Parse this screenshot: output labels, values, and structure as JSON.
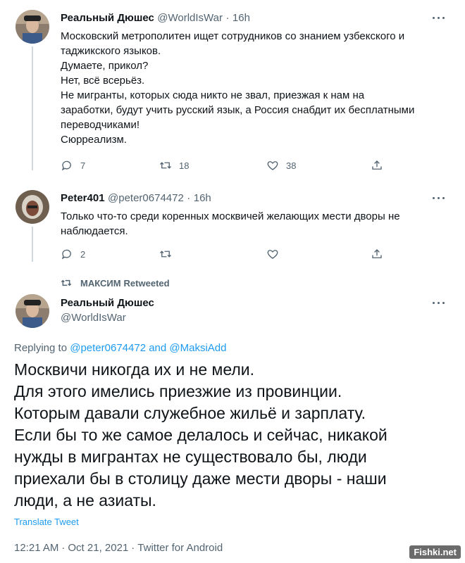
{
  "tweet1": {
    "name": "Реальный Дюшес",
    "handle": "@WorldIsWar",
    "time": "16h",
    "lines": [
      "Московский метрополитен ищет сотрудников со знанием узбекского и",
      "таджикского языков.",
      "Думаете, прикол?",
      "Нет, всё всерьёз.",
      "Не мигранты, которых сюда никто не звал, приезжая к нам на",
      "заработки, будут учить русский язык, а Россия снабдит их бесплатными",
      "переводчиками!",
      "Сюрреализм."
    ],
    "replies": "7",
    "retweets": "18",
    "likes": "38"
  },
  "tweet2": {
    "name": "Peter401",
    "handle": "@peter0674472",
    "time": "16h",
    "lines": [
      "Только что-то среди коренных москвичей желающих мести дворы не",
      "наблюдается."
    ],
    "replies": "2"
  },
  "retweet_banner": {
    "user": "МАКСИМ",
    "label": "Retweeted"
  },
  "main_tweet": {
    "name": "Реальный Дюшес",
    "handle": "@WorldIsWar",
    "replying_prefix": "Replying to",
    "replying_user1": "@peter0674472",
    "replying_and": "and",
    "replying_user2": "@MaksiAdd",
    "lines": [
      "Москвичи никогда их и не мели.",
      "Для этого имелись приезжие из провинции.",
      "Которым давали служебное жильё и зарплату.",
      "Если бы то же самое делалось и сейчас, никакой",
      "нужды в мигрантах не существовало бы, люди",
      "приехали бы в столицу даже мести дворы - наши",
      "люди, а не азиаты."
    ],
    "translate": "Translate Tweet",
    "time": "12:21 AM",
    "date": "Oct 21, 2021",
    "client": "Twitter for Android"
  },
  "watermark": "Fishki.net",
  "colors": {
    "accent": "#1d9bf0",
    "secondary_text": "#536471",
    "primary_text": "#0f1419",
    "thread_line": "#cfd9de"
  },
  "icons": [
    "reply-icon",
    "retweet-icon",
    "like-icon",
    "share-icon",
    "more-icon",
    "avatar"
  ]
}
